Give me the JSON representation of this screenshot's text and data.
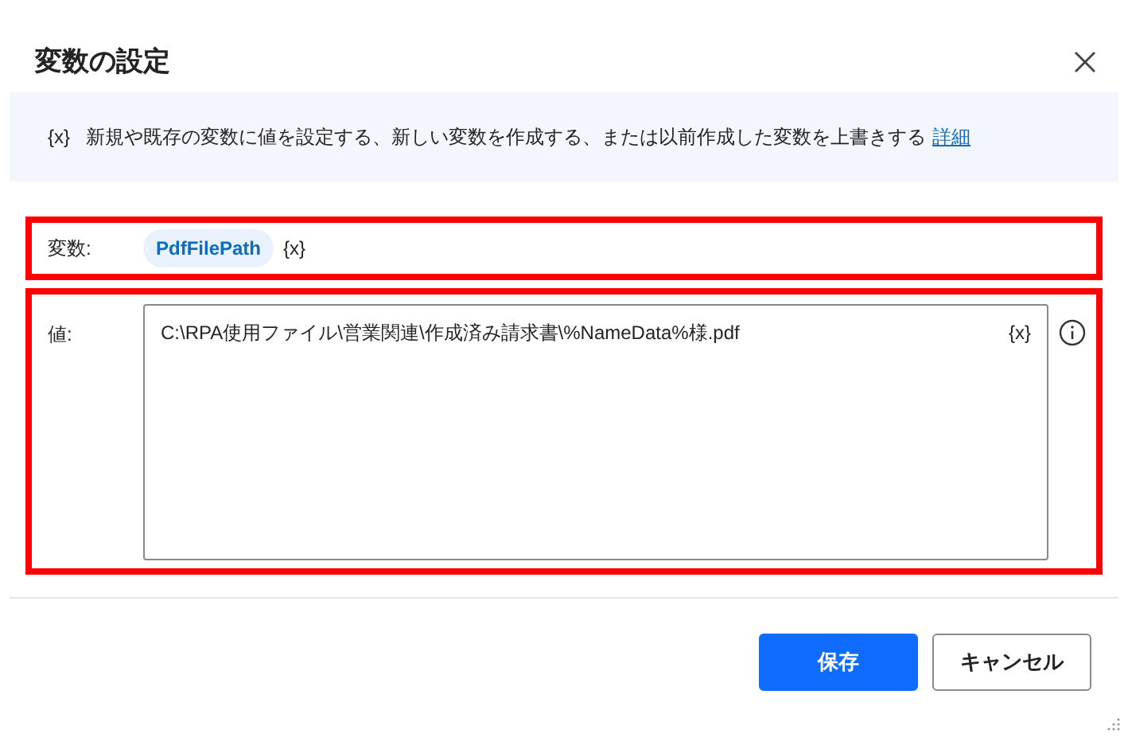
{
  "dialog": {
    "title": "変数の設定"
  },
  "info_bar": {
    "symbol": "{x}",
    "text": "新規や既存の変数に値を設定する、新しい変数を作成する、または以前作成した変数を上書きする",
    "link": "詳細"
  },
  "variable_row": {
    "label": "変数:",
    "token": "PdfFilePath",
    "symbol": "{x}",
    "highlighted": true
  },
  "value_row": {
    "label": "値:",
    "value": "C:\\RPA使用ファイル\\営業関連\\作成済み請求書\\%NameData%様.pdf",
    "symbol": "{x}",
    "highlighted": true
  },
  "buttons": [
    {
      "label": "保存",
      "kind": "primary"
    },
    {
      "label": "キャンセル",
      "kind": "secondary"
    }
  ]
}
